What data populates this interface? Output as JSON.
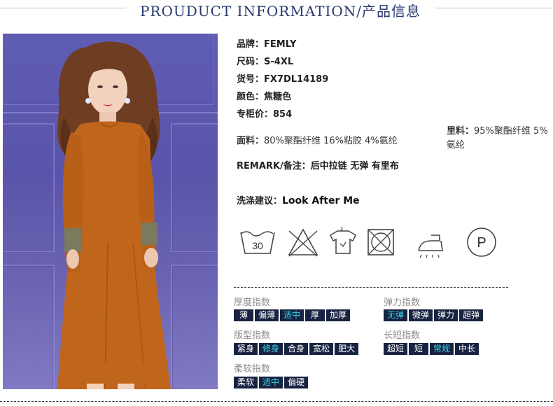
{
  "header": {
    "title": "PROUDUCT INFORMATION/产品信息"
  },
  "specs": [
    {
      "key": "品牌：",
      "value": "FEMLY"
    },
    {
      "key": "尺码：",
      "value": "S-4XL"
    },
    {
      "key": "货号：",
      "value": "FX7DL14189"
    },
    {
      "key": "颜色：",
      "value": "焦糖色"
    },
    {
      "key": "专柜价：",
      "value": "854"
    }
  ],
  "fabric": {
    "key": "面料：",
    "value": "80%聚酯纤维 16%粘胶 4%氨纶"
  },
  "lining": {
    "key": "里料：",
    "value": "95%聚酯纤维 5%氨纶"
  },
  "remark": {
    "key": "REMARK/备注：",
    "value": "后中拉链 无弹 有里布"
  },
  "wash": {
    "key": "洗涤建议：",
    "value": "Look After Me"
  },
  "care_icons": [
    {
      "icon": "wash-30-icon",
      "text": "30"
    },
    {
      "icon": "no-bleach-icon"
    },
    {
      "icon": "hang-dry-icon"
    },
    {
      "icon": "no-tumble-dry-icon"
    },
    {
      "icon": "iron-icon"
    },
    {
      "icon": "dry-clean-p-icon",
      "text": "P"
    }
  ],
  "indexes": {
    "thickness": {
      "label": "厚度指数",
      "options": [
        "薄",
        "偏薄",
        "适中",
        "厚",
        "加厚"
      ],
      "selected": "适中"
    },
    "elasticity": {
      "label": "弹力指数",
      "options": [
        "无弹",
        "微弹",
        "弹力",
        "超弹"
      ],
      "selected": "无弹"
    },
    "fit": {
      "label": "版型指数",
      "options": [
        "紧身",
        "修身",
        "合身",
        "宽松",
        "肥大"
      ],
      "selected": "修身"
    },
    "length": {
      "label": "长短指数",
      "options": [
        "超短",
        "短",
        "常规",
        "中长"
      ],
      "selected": "常规"
    },
    "softness": {
      "label": "柔软指数",
      "options": [
        "柔软",
        "适中",
        "偏硬"
      ],
      "selected": "适中"
    }
  },
  "colors": {
    "chip_bg": "#182342",
    "chip_selected_text": "#38d3e8",
    "title": "#2a3a70",
    "dress": "#c0651c"
  }
}
